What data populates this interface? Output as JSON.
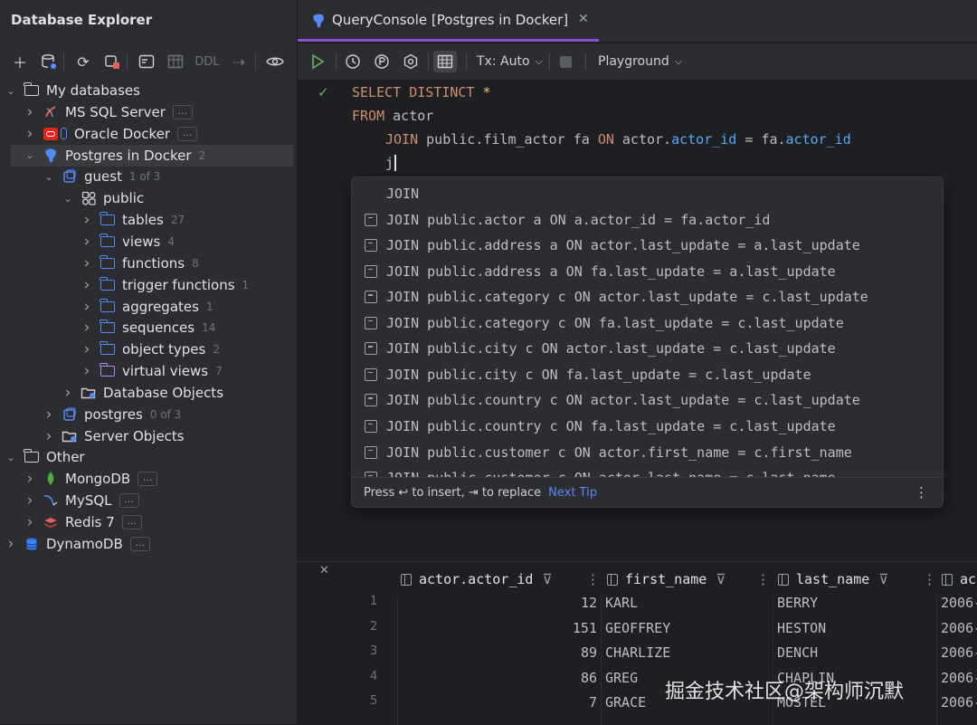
{
  "explorer": {
    "title": "Database Explorer",
    "tree": [
      {
        "id": "my-databases",
        "label": "My databases",
        "count": "",
        "icon": "folder",
        "chev": "v",
        "indent": 0,
        "dots": false,
        "selected": false
      },
      {
        "id": "ms-sql-server",
        "label": "MS SQL Server",
        "count": "",
        "icon": "mssql",
        "chev": ">",
        "indent": 1,
        "dots": true,
        "selected": false
      },
      {
        "id": "oracle-docker",
        "label": "Oracle Docker",
        "count": "",
        "icon": "oracle",
        "chev": ">",
        "indent": 1,
        "dots": true,
        "selected": false
      },
      {
        "id": "postgres-in-docker",
        "label": "Postgres in Docker",
        "count": "2",
        "icon": "postgres",
        "chev": "v",
        "indent": 1,
        "dots": false,
        "selected": true
      },
      {
        "id": "guest",
        "label": "guest",
        "count": "1 of 3",
        "icon": "db",
        "chev": "v",
        "indent": 2,
        "dots": false,
        "selected": false
      },
      {
        "id": "public",
        "label": "public",
        "count": "",
        "icon": "schema",
        "chev": "v",
        "indent": 3,
        "dots": false,
        "selected": false
      },
      {
        "id": "tables",
        "label": "tables",
        "count": "27",
        "icon": "folder-blue",
        "chev": ">",
        "indent": 4,
        "dots": false,
        "selected": false
      },
      {
        "id": "views",
        "label": "views",
        "count": "4",
        "icon": "folder-blue",
        "chev": ">",
        "indent": 4,
        "dots": false,
        "selected": false
      },
      {
        "id": "functions",
        "label": "functions",
        "count": "8",
        "icon": "folder-blue",
        "chev": ">",
        "indent": 4,
        "dots": false,
        "selected": false
      },
      {
        "id": "trigger-functions",
        "label": "trigger functions",
        "count": "1",
        "icon": "folder-blue",
        "chev": ">",
        "indent": 4,
        "dots": false,
        "selected": false
      },
      {
        "id": "aggregates",
        "label": "aggregates",
        "count": "1",
        "icon": "folder-blue",
        "chev": ">",
        "indent": 4,
        "dots": false,
        "selected": false
      },
      {
        "id": "sequences",
        "label": "sequences",
        "count": "14",
        "icon": "folder-blue",
        "chev": ">",
        "indent": 4,
        "dots": false,
        "selected": false
      },
      {
        "id": "object-types",
        "label": "object types",
        "count": "2",
        "icon": "folder-blue",
        "chev": ">",
        "indent": 4,
        "dots": false,
        "selected": false
      },
      {
        "id": "virtual-views",
        "label": "virtual views",
        "count": "7",
        "icon": "folder-purple",
        "chev": ">",
        "indent": 4,
        "dots": false,
        "selected": false
      },
      {
        "id": "database-objects",
        "label": "Database Objects",
        "count": "",
        "icon": "folder-db",
        "chev": ">",
        "indent": 3,
        "dots": false,
        "selected": false
      },
      {
        "id": "postgres",
        "label": "postgres",
        "count": "0 of 3",
        "icon": "db",
        "chev": ">",
        "indent": 2,
        "dots": false,
        "selected": false
      },
      {
        "id": "server-objects",
        "label": "Server Objects",
        "count": "",
        "icon": "folder-db",
        "chev": ">",
        "indent": 2,
        "dots": false,
        "selected": false
      },
      {
        "id": "other",
        "label": "Other",
        "count": "",
        "icon": "folder",
        "chev": "v",
        "indent": 0,
        "dots": false,
        "selected": false
      },
      {
        "id": "mongodb",
        "label": "MongoDB",
        "count": "",
        "icon": "mongo",
        "chev": ">",
        "indent": 1,
        "dots": true,
        "selected": false
      },
      {
        "id": "mysql",
        "label": "MySQL",
        "count": "",
        "icon": "mysql",
        "chev": ">",
        "indent": 1,
        "dots": true,
        "selected": false
      },
      {
        "id": "redis-7",
        "label": "Redis 7",
        "count": "",
        "icon": "redis",
        "chev": ">",
        "indent": 1,
        "dots": true,
        "selected": false
      },
      {
        "id": "dynamodb",
        "label": "DynamoDB",
        "count": "",
        "icon": "dynamo",
        "chev": ">",
        "indent": 0,
        "dots": true,
        "selected": false
      }
    ],
    "dots_label": "...",
    "toolbar": {
      "ddl_label": "DDL"
    }
  },
  "tab": {
    "label": "QueryConsole [Postgres in Docker]",
    "close": "✕"
  },
  "editor_toolbar": {
    "tx_label": "Tx: Auto",
    "playground_label": "Playground"
  },
  "editor": {
    "line1_kw1": "SELECT",
    "line1_kw2": "DISTINCT",
    "line1_star": "*",
    "line2_kw": "FROM",
    "line2_table": "actor",
    "line3_kw": "JOIN",
    "line3_table": "public.film_actor fa",
    "line3_on": "ON",
    "line3_left_tbl": "actor.",
    "line3_left_col": "actor_id",
    "line3_eq": " = ",
    "line3_right_tbl": "fa.",
    "line3_right_col": "actor_id",
    "line4_typed": "j"
  },
  "completion": {
    "first": "JOIN",
    "items": [
      "JOIN public.actor a ON a.actor_id = fa.actor_id",
      "JOIN public.address a ON actor.last_update = a.last_update",
      "JOIN public.address a ON fa.last_update = a.last_update",
      "JOIN public.category c ON actor.last_update = c.last_update",
      "JOIN public.category c ON fa.last_update = c.last_update",
      "JOIN public.city c ON actor.last_update = c.last_update",
      "JOIN public.city c ON fa.last_update = c.last_update",
      "JOIN public.country c ON actor.last_update = c.last_update",
      "JOIN public.country c ON fa.last_update = c.last_update",
      "JOIN public.customer c ON actor.first_name = c.first_name",
      "JOIN public.customer c ON actor.last_name = c.last_name"
    ],
    "footer_text": "Press ↩ to insert, ⇥ to replace",
    "next_tip": "Next Tip"
  },
  "results": {
    "columns": [
      "actor.actor_id",
      "first_name",
      "last_name",
      "ac"
    ],
    "rows": [
      {
        "n": "1",
        "id": "12",
        "first": "KARL",
        "last": "BERRY",
        "date": "2006-"
      },
      {
        "n": "2",
        "id": "151",
        "first": "GEOFFREY",
        "last": "HESTON",
        "date": "2006-"
      },
      {
        "n": "3",
        "id": "89",
        "first": "CHARLIZE",
        "last": "DENCH",
        "date": "2006-"
      },
      {
        "n": "4",
        "id": "86",
        "first": "GREG",
        "last": "CHAPLIN",
        "date": "2006-"
      },
      {
        "n": "5",
        "id": "7",
        "first": "GRACE",
        "last": "MOSTEL",
        "date": "2006-"
      }
    ]
  },
  "watermark": "掘金技术社区@架构师沉默",
  "colors": {
    "accent": "#8a4dd6",
    "keyword": "#cf8e6d",
    "identifier": "#56a8f5",
    "link": "#548af7"
  }
}
